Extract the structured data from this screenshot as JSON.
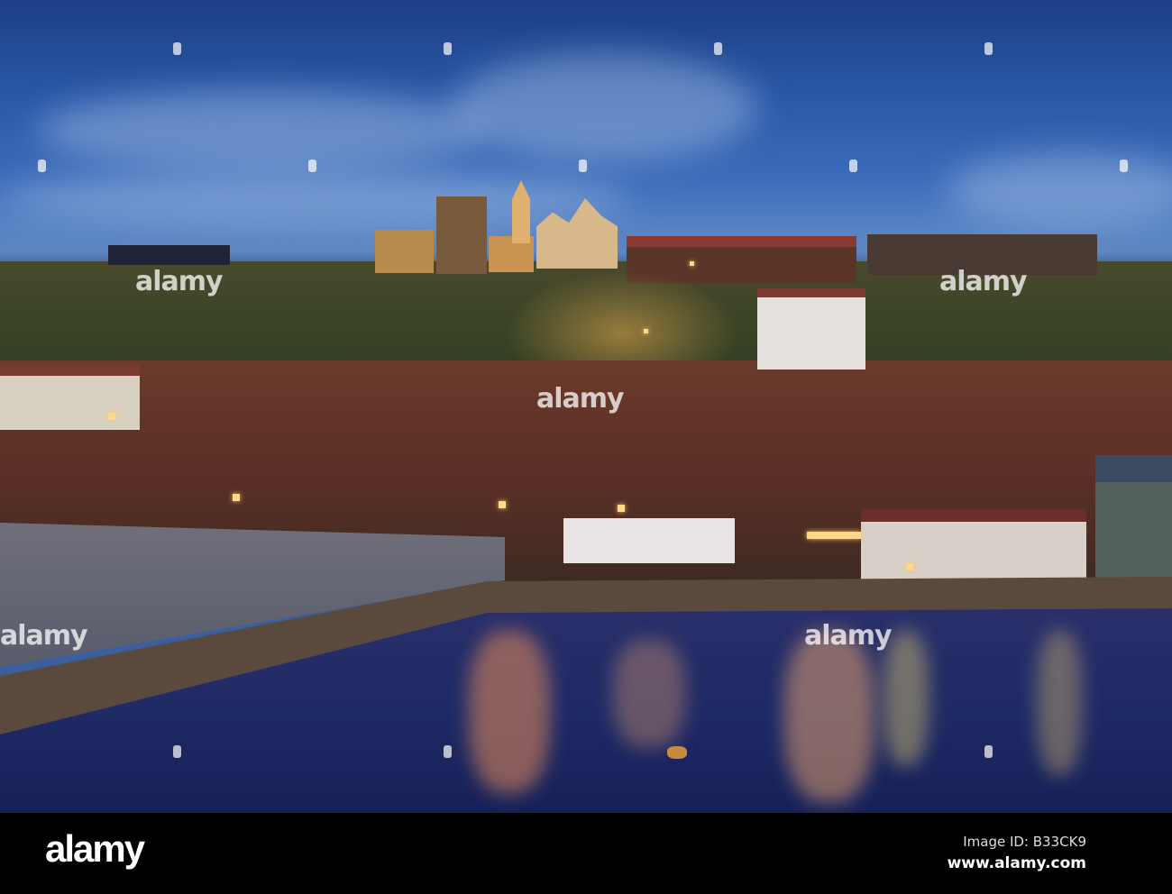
{
  "photo": {
    "subject": "Whitby harbour at dusk",
    "colors": {
      "sky": "#2a58a8",
      "water": "#1f2a66",
      "light": "#ffd98a"
    }
  },
  "watermark": {
    "text": "alamy"
  },
  "footer": {
    "logo": "alamy",
    "image_id": "Image ID: B33CK9",
    "website": "www.alamy.com"
  }
}
